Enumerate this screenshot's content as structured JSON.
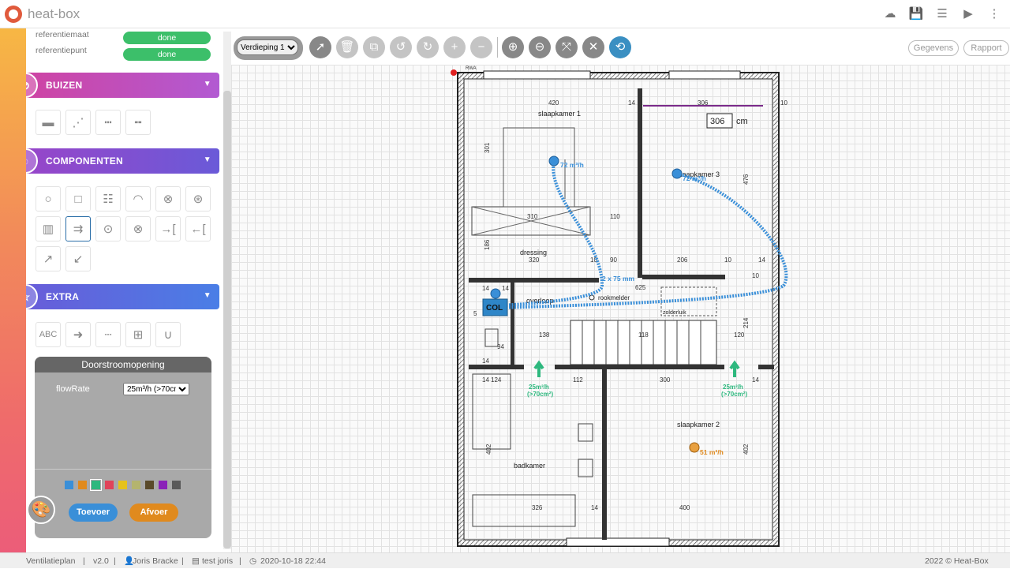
{
  "app": {
    "title": "heat-box"
  },
  "top_icons": [
    "cloud-icon",
    "save-icon",
    "document-icon",
    "video-icon",
    "more-icon"
  ],
  "sidebar": {
    "ref_rows": [
      {
        "label": "referentiemaat",
        "status": "done"
      },
      {
        "label": "referentiepunt",
        "status": "done"
      }
    ],
    "sections": {
      "buizen": "BUIZEN",
      "componenten": "COMPONENTEN",
      "extra": "EXTRA"
    },
    "buizen_tools": [
      "pipe-solid-icon",
      "pipe-flex-icon",
      "pipe-dotted-icon",
      "pipe-dashed-icon"
    ],
    "componenten_tools": [
      "circle-valve-icon",
      "square-valve-icon",
      "grille-icon",
      "hood-icon",
      "double-vent-icon",
      "rotary-vent-icon",
      "wall-unit-icon",
      "flow-arrow-icon",
      "supply-point-icon",
      "exhaust-point-icon",
      "wall-inlet-icon",
      "wall-outlet-icon",
      "roof-supply-icon",
      "roof-exhaust-icon"
    ],
    "extra_tools": {
      "text": "ABC",
      "items": [
        "arrow-icon",
        "dotted-line-icon",
        "area-icon",
        "bend-icon"
      ]
    },
    "panel": {
      "title": "Doorstroomopening",
      "field_label": "flowRate",
      "field_value": "25m³/h (>70cm²)",
      "swatches": [
        "#3a8fd8",
        "#e08a1e",
        "#2db87e",
        "#e0445a",
        "#e6c21a",
        "#b4b46e",
        "#5a4a2a",
        "#8a22b8",
        "#5a5a5a"
      ],
      "selected_swatch": 2,
      "supply_label": "Toevoer",
      "exhaust_label": "Afvoer"
    }
  },
  "toolbar": {
    "floor": "Verdieping 1",
    "floor_options": [
      "Verdieping 1"
    ],
    "buttons": [
      "select-pointer-icon",
      "delete-icon",
      "copy-icon",
      "undo-icon",
      "redo-icon",
      "add-icon",
      "remove-icon",
      "zoom-in-icon",
      "zoom-out-icon",
      "fit-icon",
      "close-icon",
      "rotate-icon"
    ],
    "gegevens": "Gegevens",
    "rapport": "Rapport"
  },
  "plan": {
    "rooms": {
      "slaapkamer1": "slaapkamer 1",
      "slaapkamer3": "slaapkamer 3",
      "slaapkamer2": "slaapkamer 2",
      "dressing": "dressing",
      "badkamer": "badkamer",
      "overloop": "overloop",
      "zolderluik": "zolderluik",
      "rookmelder": "rookmelder"
    },
    "ducts": {
      "col": "COL",
      "s1": "72 m³/h",
      "s3": "72 m³/h",
      "s2": "51 m³/h",
      "pipe": "2 x 75 mm",
      "door1": "25m³/h",
      "door1b": "(>70cm²)",
      "door2": "25m³/h",
      "door2b": "(>70cm²)"
    },
    "input_value": "306",
    "input_unit": "cm",
    "rwa": "RWA",
    "dims": [
      "420",
      "14",
      "306",
      "310",
      "110",
      "320",
      "90",
      "206",
      "10",
      "625",
      "138",
      "118",
      "120",
      "94",
      "300",
      "112",
      "124",
      "326",
      "400",
      "14",
      "14",
      "14",
      "14",
      "14",
      "10",
      "14",
      "14",
      "10",
      "5",
      "301",
      "186",
      "476",
      "402",
      "402",
      "214",
      "10"
    ]
  },
  "footer": {
    "plan": "Ventilatieplan",
    "version": "v2.0",
    "user": "Joris Bracke",
    "project": "test joris",
    "date": "2020-10-18 22:44",
    "copyright": "2022 © Heat-Box"
  },
  "colors": {
    "supply": "#3a8fd8",
    "exhaust": "#e08a1e",
    "done": "#3cbf6a",
    "buizen": "#d042a0",
    "componenten": "#7a52d6",
    "extra": "#4a7ee6"
  }
}
